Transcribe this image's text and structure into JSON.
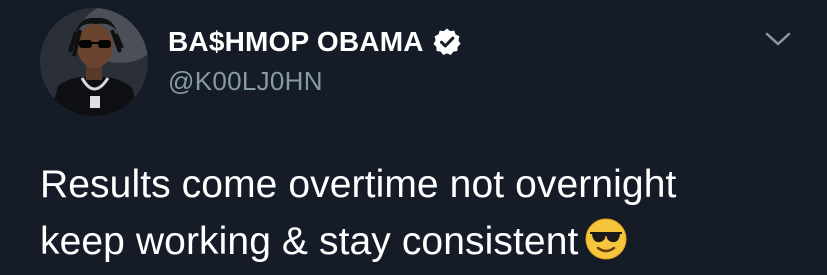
{
  "author": {
    "display_name": "BA$HMOP OBAMA",
    "handle": "@K00LJ0HN",
    "verified": true,
    "avatar_icon": "profile-photo"
  },
  "menu": {
    "icon": "chevron-down-icon"
  },
  "tweet": {
    "line1": "Results come overtime not overnight",
    "line2": "keep working & stay consistent",
    "emoji": "smiling-face-with-sunglasses"
  },
  "colors": {
    "background": "#151c27",
    "text": "#ffffff",
    "handle": "#8899a6",
    "chevron": "#8899a6"
  }
}
